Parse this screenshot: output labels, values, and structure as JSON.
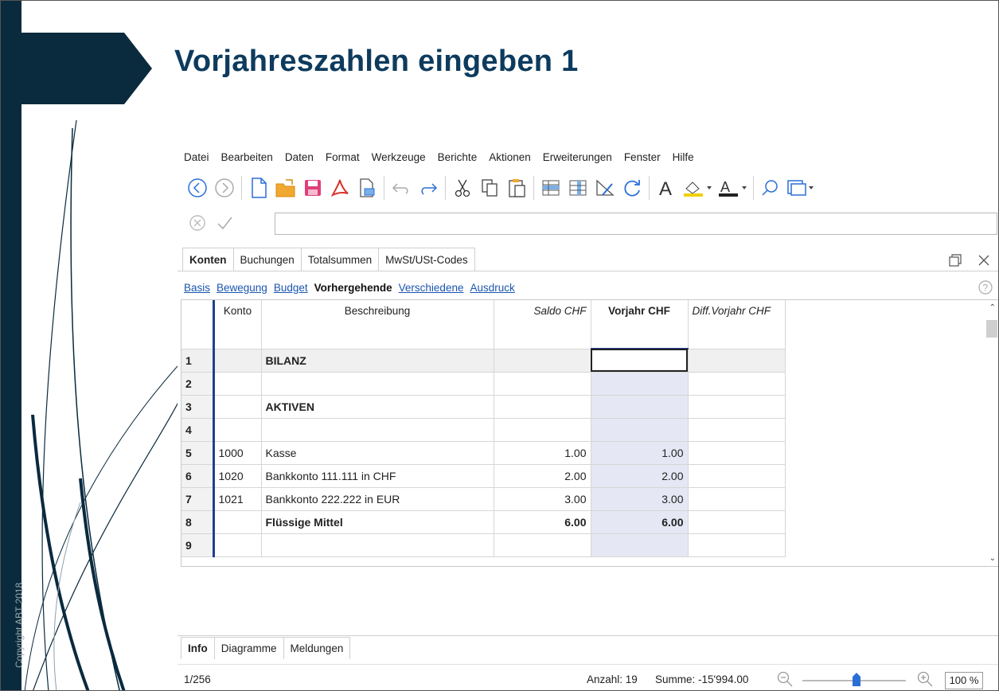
{
  "slide": {
    "title": "Vorjahreszahlen eingeben 1",
    "copyright": "Copyright ABT 2018"
  },
  "menu": [
    "Datei",
    "Bearbeiten",
    "Daten",
    "Format",
    "Werkzeuge",
    "Berichte",
    "Aktionen",
    "Erweiterungen",
    "Fenster",
    "Hilfe"
  ],
  "tabs": [
    "Konten",
    "Buchungen",
    "Totalsummen",
    "MwSt/USt-Codes"
  ],
  "views": [
    "Basis",
    "Bewegung",
    "Budget",
    "Vorhergehende",
    "Verschiedene",
    "Ausdruck"
  ],
  "table": {
    "headers": [
      "Konto",
      "Beschreibung",
      "Saldo CHF",
      "Vorjahr CHF",
      "Diff.Vorjahr CHF"
    ],
    "rows": [
      {
        "n": "1",
        "konto": "",
        "beschr": "BILANZ",
        "saldo": "",
        "vorjahr": ""
      },
      {
        "n": "2",
        "konto": "",
        "beschr": "",
        "saldo": "",
        "vorjahr": ""
      },
      {
        "n": "3",
        "konto": "",
        "beschr": "AKTIVEN",
        "saldo": "",
        "vorjahr": ""
      },
      {
        "n": "4",
        "konto": "",
        "beschr": "",
        "saldo": "",
        "vorjahr": ""
      },
      {
        "n": "5",
        "konto": "1000",
        "beschr": "Kasse",
        "saldo": "1.00",
        "vorjahr": "1.00"
      },
      {
        "n": "6",
        "konto": "1020",
        "beschr": "Bankkonto 111.111 in CHF",
        "saldo": "2.00",
        "vorjahr": "2.00"
      },
      {
        "n": "7",
        "konto": "1021",
        "beschr": "Bankkonto 222.222 in EUR",
        "saldo": "3.00",
        "vorjahr": "3.00"
      },
      {
        "n": "8",
        "konto": "",
        "beschr": "Flüssige Mittel",
        "saldo": "6.00",
        "vorjahr": "6.00"
      },
      {
        "n": "9",
        "konto": "",
        "beschr": "",
        "saldo": "",
        "vorjahr": ""
      }
    ]
  },
  "bottom_tabs": [
    "Info",
    "Diagramme",
    "Meldungen"
  ],
  "status": {
    "page": "1/256",
    "count": "Anzahl: 19",
    "sum": "Summe: -15'994.00",
    "zoom": "100 %"
  },
  "colors": {
    "title": "#0d3b5e",
    "strip": "#0a2a3e",
    "link": "#1a55b0",
    "accent": "#2a6fd6",
    "vorjahr_column": "#e5e7f4"
  }
}
